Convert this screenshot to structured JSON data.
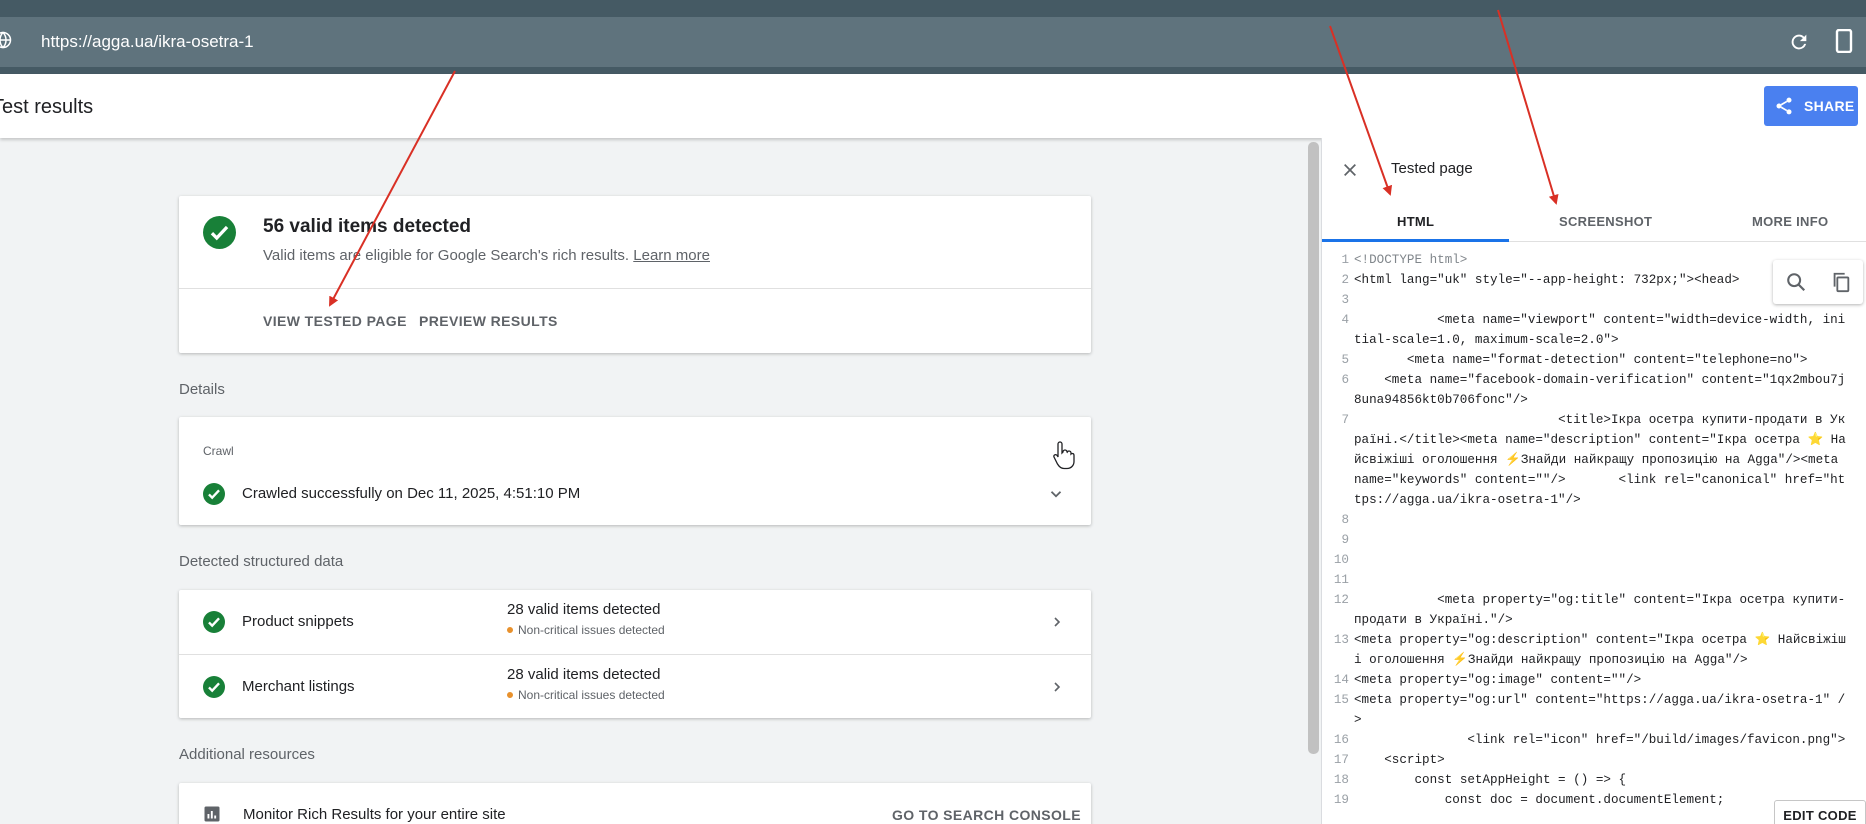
{
  "url_bar": {
    "url": "https://agga.ua/ikra-osetra-1"
  },
  "header": {
    "title": "Test results",
    "share_label": "SHARE"
  },
  "summary": {
    "title": "56 valid items detected",
    "subtitle": "Valid items are eligible for Google Search's rich results.",
    "learn_more": "Learn more",
    "view_tested_page": "VIEW TESTED PAGE",
    "preview_results": "PREVIEW RESULTS"
  },
  "details": {
    "label": "Details",
    "crawl_label": "Crawl",
    "crawl_text": "Crawled successfully on Dec 11, 2025, 4:51:10 PM"
  },
  "structured": {
    "label": "Detected structured data",
    "rows": [
      {
        "name": "Product snippets",
        "count": "28 valid items detected",
        "issue": "Non-critical issues detected"
      },
      {
        "name": "Merchant listings",
        "count": "28 valid items detected",
        "issue": "Non-critical issues detected"
      }
    ]
  },
  "resources": {
    "label": "Additional resources",
    "text": "Monitor Rich Results for your entire site",
    "button": "GO TO SEARCH CONSOLE"
  },
  "panel": {
    "title": "Tested page",
    "tabs": [
      "HTML",
      "SCREENSHOT",
      "MORE INFO"
    ],
    "active_tab": "HTML",
    "edit_code": "EDIT CODE"
  },
  "code_lines": [
    {
      "n": "1",
      "text": "<!DOCTYPE html>"
    },
    {
      "n": "2",
      "text": "<html lang=\"uk\" style=\"--app-height: 732px;\"><head>"
    },
    {
      "n": "3",
      "text": ""
    },
    {
      "n": "4",
      "text": "           <meta name=\"viewport\" content=\"width=device-width, initial-scale=1.0, maximum-scale=2.0\">"
    },
    {
      "n": "5",
      "text": "       <meta name=\"format-detection\" content=\"telephone=no\">"
    },
    {
      "n": "6",
      "text": "    <meta name=\"facebook-domain-verification\" content=\"1qx2mbou7j8una94856kt0b706fonc\"/>"
    },
    {
      "n": "7",
      "text": "                           <title>Ікра осетра купити-продати в Україні.</title><meta name=\"description\" content=\"Ікра осетра ⭐ Найсвіжіші оголошення ⚡Знайди найкращу пропозицію на Agga\"/><meta name=\"keywords\" content=\"\"/>       <link rel=\"canonical\" href=\"https://agga.ua/ikra-osetra-1\"/>"
    },
    {
      "n": "8",
      "text": ""
    },
    {
      "n": "9",
      "text": ""
    },
    {
      "n": "10",
      "text": ""
    },
    {
      "n": "11",
      "text": ""
    },
    {
      "n": "12",
      "text": "           <meta property=\"og:title\" content=\"Ікра осетра купити-продати в Україні.\"/>"
    },
    {
      "n": "13",
      "text": "<meta property=\"og:description\" content=\"Ікра осетра ⭐ Найсвіжіші оголошення ⚡Знайди найкращу пропозицію на Agga\"/>"
    },
    {
      "n": "14",
      "text": "<meta property=\"og:image\" content=\"\"/>"
    },
    {
      "n": "15",
      "text": "<meta property=\"og:url\" content=\"https://agga.ua/ikra-osetra-1\" />"
    },
    {
      "n": "16",
      "text": "               <link rel=\"icon\" href=\"/build/images/favicon.png\">"
    },
    {
      "n": "17",
      "text": "    <script>"
    },
    {
      "n": "18",
      "text": "        const setAppHeight = () => {"
    },
    {
      "n": "19",
      "text": "            const doc = document.documentElement;"
    }
  ]
}
